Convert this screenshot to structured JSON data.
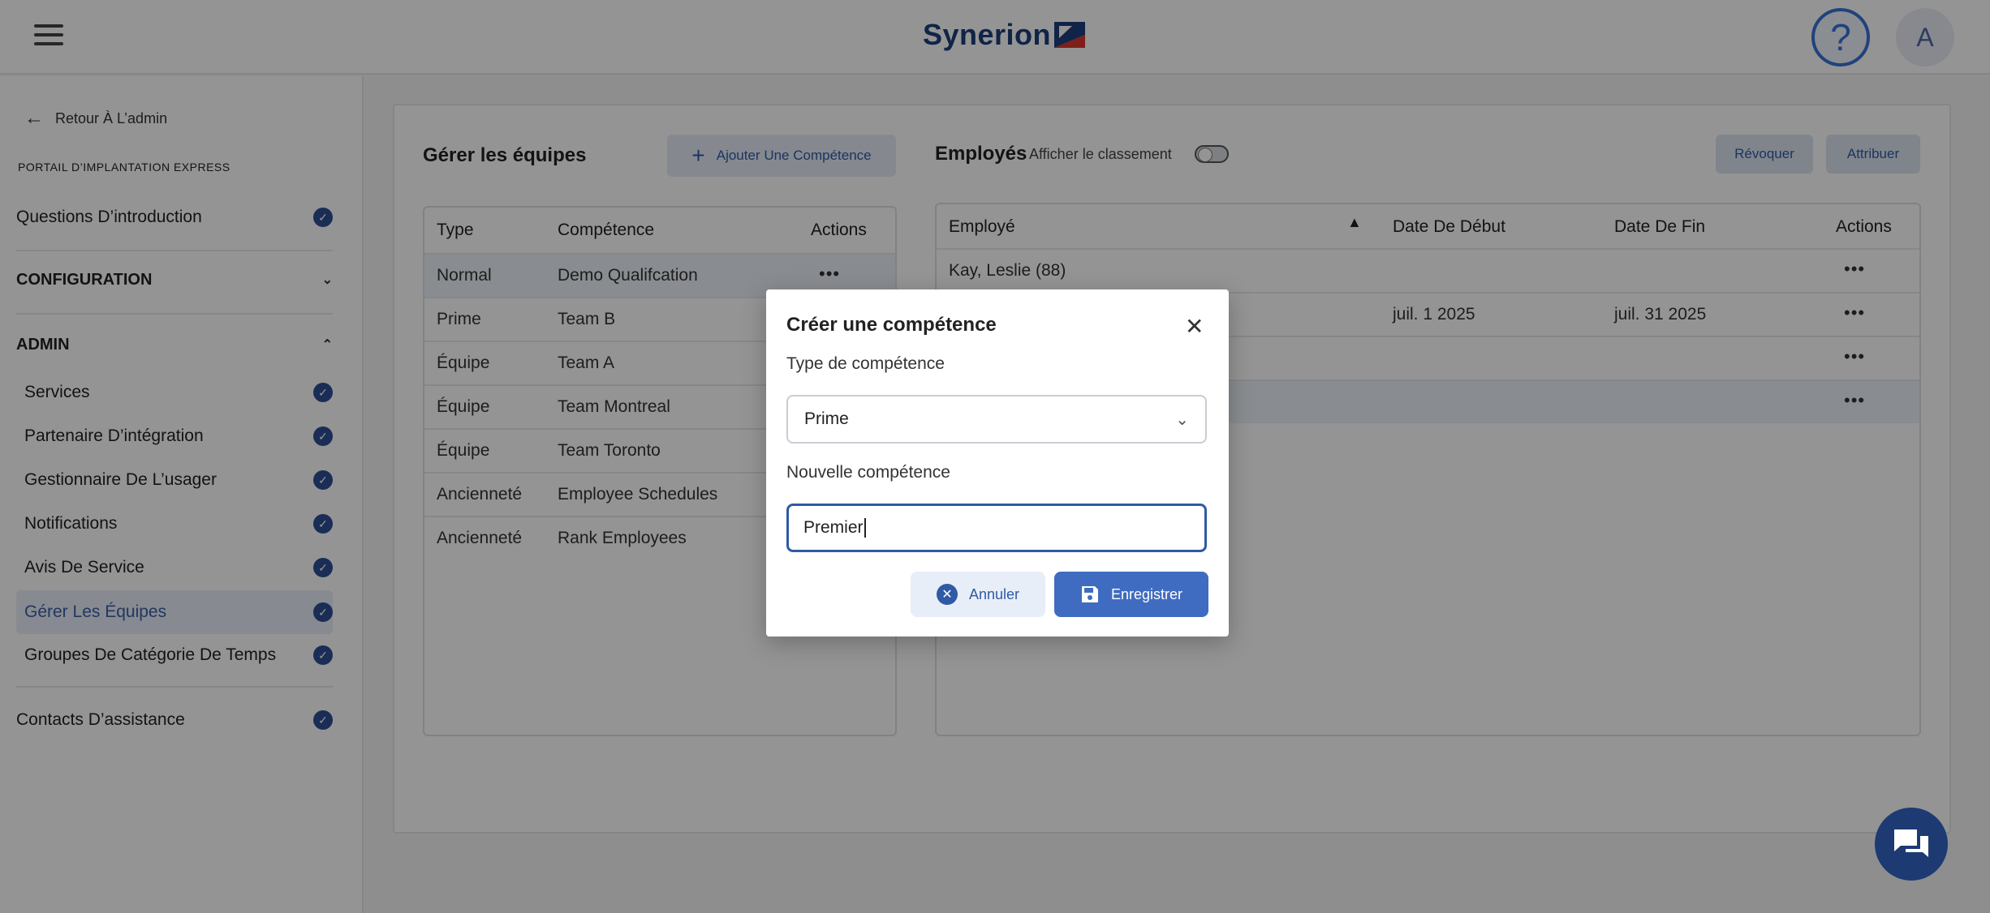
{
  "header": {
    "logo_text": "Synerion",
    "help_icon": "?",
    "avatar_letter": "A"
  },
  "sidebar": {
    "back_label": "Retour À L’admin",
    "portal_title": "PORTAIL D’IMPLANTATION EXPRESS",
    "intro": "Questions D’introduction",
    "configuration": "CONFIGURATION",
    "admin": "ADMIN",
    "admin_items": [
      "Services",
      "Partenaire D’intégration",
      "Gestionnaire De L’usager",
      "Notifications",
      "Avis De Service",
      "Gérer Les Équipes",
      "Groupes De Catégorie De Temps"
    ],
    "support": "Contacts D’assistance"
  },
  "teams": {
    "title": "Gérer les équipes",
    "add_button": "Ajouter Une Compétence",
    "columns": [
      "Type",
      "Compétence",
      "Actions"
    ],
    "rows": [
      [
        "Normal",
        "Demo Qualifcation"
      ],
      [
        "Prime",
        "Team B"
      ],
      [
        "Équipe",
        "Team A"
      ],
      [
        "Équipe",
        "Team Montreal"
      ],
      [
        "Équipe",
        "Team Toronto"
      ],
      [
        "Ancienneté",
        "Employee Schedules"
      ],
      [
        "Ancienneté",
        "Rank Employees"
      ]
    ]
  },
  "employees": {
    "title": "Employés",
    "toggle_label": "Afficher le classement",
    "revoke": "Révoquer",
    "assign": "Attribuer",
    "columns": [
      "Employé",
      "Date De Début",
      "Date De Fin",
      "Actions"
    ],
    "rows": [
      [
        "Kay, Leslie (88)",
        "",
        ""
      ],
      [
        "",
        "juil. 1 2025",
        "juil. 31 2025"
      ],
      [
        "",
        "",
        ""
      ],
      [
        "",
        "",
        ""
      ]
    ]
  },
  "modal": {
    "title": "Créer une compétence",
    "type_label": "Type de compétence",
    "type_value": "Prime",
    "new_label": "Nouvelle compétence",
    "new_value": "Premier",
    "cancel": "Annuler",
    "save": "Enregistrer"
  },
  "colors": {
    "primary": "#2f5aa6",
    "brand": "#1d3f7c",
    "overlay": "rgba(0,0,0,0.42)"
  }
}
